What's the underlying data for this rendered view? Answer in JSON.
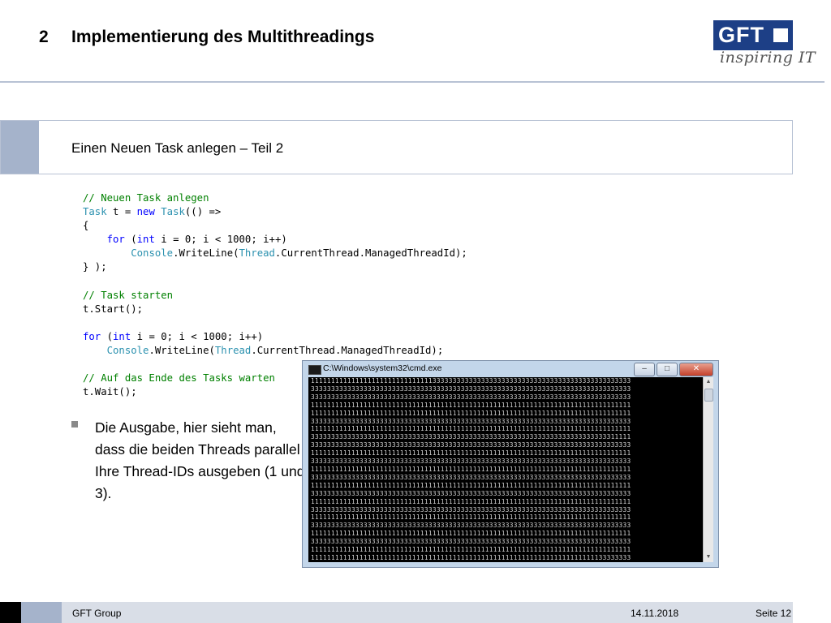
{
  "header": {
    "section_number": "2",
    "title": "Implementierung des Multithreadings"
  },
  "logo": {
    "text": "GFT",
    "tagline": "inspiring IT",
    "brand_color": "#1d3f86"
  },
  "subtitle": "Einen Neuen Task anlegen – Teil 2",
  "code": [
    [
      {
        "t": "// Neuen Task anlegen",
        "c": "comment"
      }
    ],
    [
      {
        "t": "Task",
        "c": "type"
      },
      {
        "t": " t = ",
        "c": "plain"
      },
      {
        "t": "new",
        "c": "kw"
      },
      {
        "t": " ",
        "c": "plain"
      },
      {
        "t": "Task",
        "c": "type"
      },
      {
        "t": "(() =>",
        "c": "plain"
      }
    ],
    [
      {
        "t": "{",
        "c": "plain"
      }
    ],
    [
      {
        "t": "    ",
        "c": "plain"
      },
      {
        "t": "for",
        "c": "kw"
      },
      {
        "t": " (",
        "c": "plain"
      },
      {
        "t": "int",
        "c": "kw"
      },
      {
        "t": " i = 0; i < 1000; i++)",
        "c": "plain"
      }
    ],
    [
      {
        "t": "        ",
        "c": "plain"
      },
      {
        "t": "Console",
        "c": "type"
      },
      {
        "t": ".WriteLine(",
        "c": "plain"
      },
      {
        "t": "Thread",
        "c": "type"
      },
      {
        "t": ".CurrentThread.ManagedThreadId);",
        "c": "plain"
      }
    ],
    [
      {
        "t": "} );",
        "c": "plain"
      }
    ],
    [],
    [
      {
        "t": "// Task starten",
        "c": "comment"
      }
    ],
    [
      {
        "t": "t.Start();",
        "c": "plain"
      }
    ],
    [],
    [
      {
        "t": "for",
        "c": "kw"
      },
      {
        "t": " (",
        "c": "plain"
      },
      {
        "t": "int",
        "c": "kw"
      },
      {
        "t": " i = 0; i < 1000; i++)",
        "c": "plain"
      }
    ],
    [
      {
        "t": "    ",
        "c": "plain"
      },
      {
        "t": "Console",
        "c": "type"
      },
      {
        "t": ".WriteLine(",
        "c": "plain"
      },
      {
        "t": "Thread",
        "c": "type"
      },
      {
        "t": ".CurrentThread.ManagedThreadId);",
        "c": "plain"
      }
    ],
    [],
    [
      {
        "t": "// Auf das Ende des Tasks warten",
        "c": "comment"
      }
    ],
    [
      {
        "t": "t.Wait();",
        "c": "plain"
      }
    ]
  ],
  "bullet": "Die Ausgabe, hier sieht man, dass die beiden Threads parallel Ihre Thread-IDs ausgeben (1 und 3).",
  "console": {
    "title": "C:\\Windows\\system32\\cmd.exe",
    "buttons": [
      "minimize",
      "maximize",
      "close"
    ],
    "lines": [
      "1111111111111111111111111111113333333333333333333333333333333333333333333333333",
      "3333333333333333333333333333333333333333333333333333333333333333333333333333333",
      "3333333333333333333333333333333333333333333333333333333333333333333333333333333",
      "1111111111111111111111111111111111111111111111111111111111111111111111111111111",
      "1111111111111111111111111111111111111111111111111111111111111111111111111111111",
      "3333333333333333333333333333333333333333333333333333333333333333333333333333333",
      "1111111111111111111111111111111111111111111111111111111111111111111111111111111",
      "3333333333333333333333333333333333333333333333333333333333333333333333333311111",
      "3333333333333333333333333333333333333333333333333333333333333333333333333333333",
      "1111111111111111111111111111111111111111111111111111111111111111111111111111111",
      "3333333333333333333333333333333333333333333333333333333333333333333333333333333",
      "1111111111111111111111111111111111111111111111111111111111111111111111111111111",
      "3333333333333333333333333333333333333333333333333333333333333333333333333333333",
      "1111111111111111111111111111111111111111111111111111111111111111111111111111111",
      "3333333333333333333333333333333333333333333333333333333333333333333333333333333",
      "1111111111111111111111111111111111111111111111111111111111111111111111111111111",
      "3333333333333333333333333333333333333333333333333333333333333333333333333333333",
      "1111111111111111111111111111111111111111111111111111111111111111111111111111111",
      "3333333333333333333333333333333333333333333333333333333333333333333333333333333",
      "1111111111111111111111111111111111111111111111111111111111111111111111111111111",
      "3333333333333333333333333333333333333333333333333333333333333333333333333333333",
      "1111111111111111111111111111111111111111111111111111111111111111111111111111111",
      "1111111111111111111111111111111111111111111111111111111111111111111111133333333",
      "3333333333333333333333333333333333333333333333333333333333333333333333333333333"
    ]
  },
  "footer": {
    "company": "GFT Group",
    "date": "14.11.2018",
    "page": "Seite 12"
  }
}
